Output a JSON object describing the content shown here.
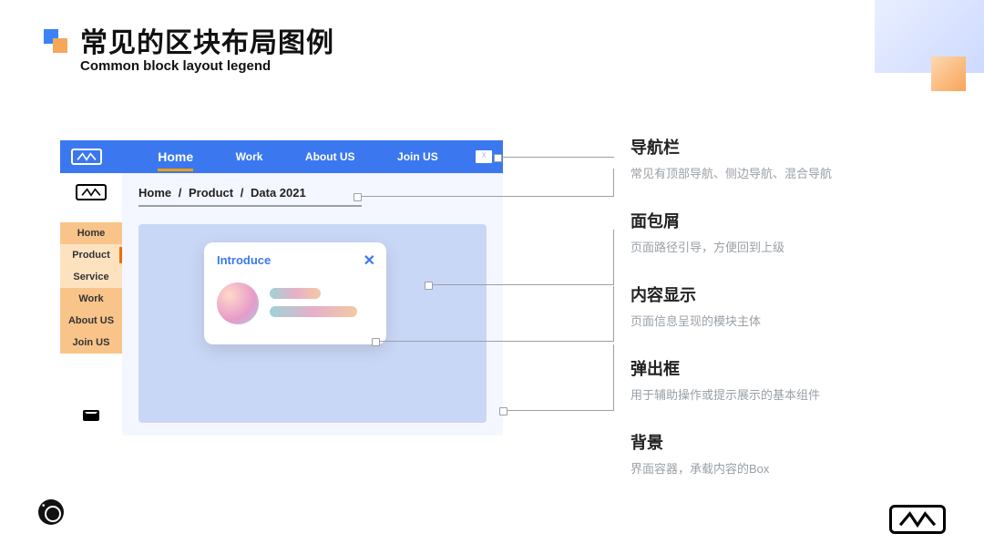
{
  "title": {
    "cn": "常见的区块布局图例",
    "en": "Common block layout legend"
  },
  "topnav": {
    "items": [
      "Home",
      "Work",
      "About US",
      "Join US"
    ],
    "active_index": 0
  },
  "sidebar": {
    "items": [
      {
        "label": "Home",
        "style": "orange"
      },
      {
        "label": "Product",
        "style": "orange-light bar"
      },
      {
        "label": "Service",
        "style": "orange-light"
      },
      {
        "label": "Work",
        "style": "orange"
      },
      {
        "label": "About US",
        "style": "orange"
      },
      {
        "label": "Join US",
        "style": "orange"
      }
    ]
  },
  "breadcrumb": {
    "parts": [
      "Home",
      "Product",
      "Data 2021"
    ],
    "current_index": 2
  },
  "popup": {
    "title": "Introduce"
  },
  "legend": [
    {
      "h": "导航栏",
      "p": "常见有顶部导航、侧边导航、混合导航"
    },
    {
      "h": "面包屑",
      "p": "页面路径引导，方便回到上级"
    },
    {
      "h": "内容显示",
      "p": "页面信息呈现的模块主体"
    },
    {
      "h": "弹出框",
      "p": "用于辅助操作或提示展示的基本组件"
    },
    {
      "h": "背景",
      "p": "界面容器，承载内容的Box"
    }
  ]
}
